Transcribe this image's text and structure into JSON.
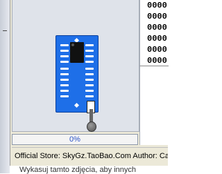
{
  "hex_view": {
    "rows": [
      "0000",
      "0000",
      "0000",
      "0000",
      "0000",
      "0000"
    ]
  },
  "programmer": {
    "progress_percent": 0,
    "progress_label": "0%"
  },
  "status_bar": {
    "text": "Official Store: SkyGz.TaoBao.Com Author: Cam"
  },
  "background_window": {
    "text": "Wykasuj tamto zdjęcia, aby innych"
  },
  "colors": {
    "board": "#1e6fe8",
    "progress_text": "#2a52c8",
    "panel": "#dfe3ea"
  }
}
